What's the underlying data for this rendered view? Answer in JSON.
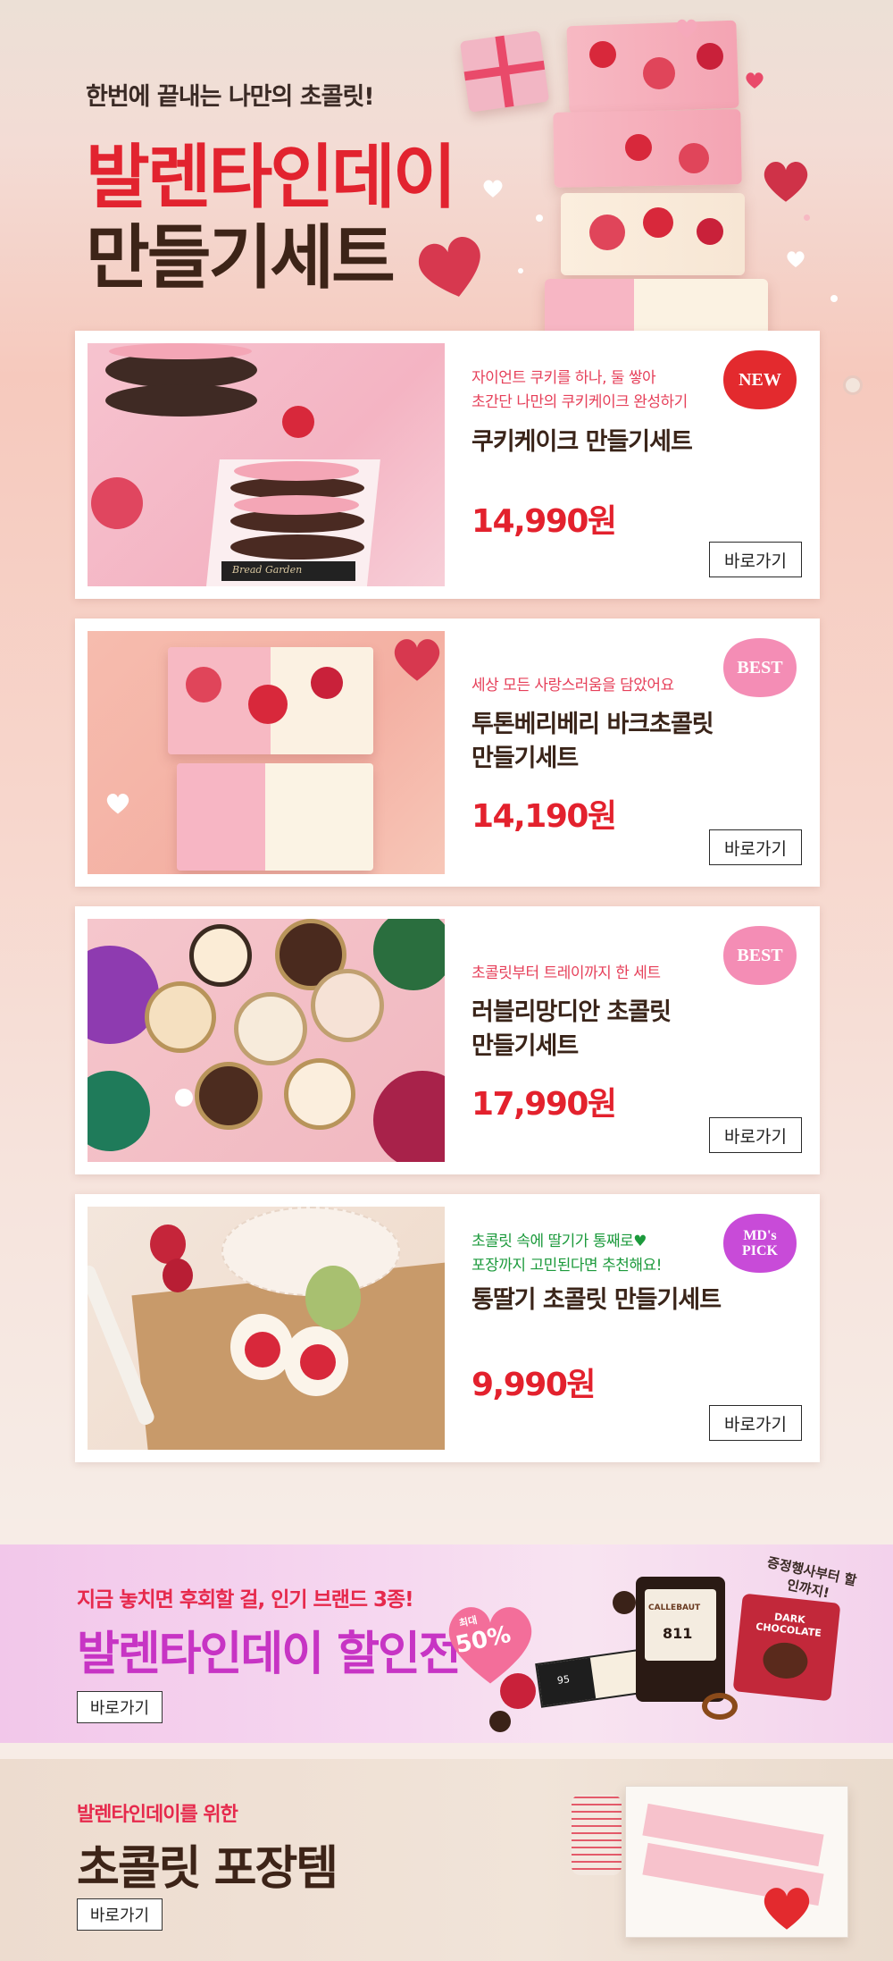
{
  "hero": {
    "pre_title": "한번에 끝내는 나만의 초콜릿!",
    "title_line1": "발렌타인데이",
    "title_line2": "만들기세트"
  },
  "products": [
    {
      "badge": "NEW",
      "description": [
        "자이언트 쿠키를 하나, 둘 쌓아",
        "초간단 나만의 쿠키케이크 완성하기"
      ],
      "name": [
        "쿠키케이크 만들기세트"
      ],
      "price": "14,990원",
      "button": "바로가기",
      "image_text": "Bread Garden"
    },
    {
      "badge": "BEST",
      "description": [
        "세상 모든 사랑스러움을 담았어요"
      ],
      "name": [
        "투톤베리베리 바크초콜릿",
        "만들기세트"
      ],
      "price": "14,190원",
      "button": "바로가기"
    },
    {
      "badge": "BEST",
      "description": [
        "초콜릿부터 트레이까지 한 세트"
      ],
      "name": [
        "러블리망디안 초콜릿",
        "만들기세트"
      ],
      "price": "17,990원",
      "button": "바로가기"
    },
    {
      "badge": "MD's PICK",
      "description": [
        "초콜릿 속에 딸기가 통째로♥",
        "포장까지 고민된다면 추천해요!"
      ],
      "name": [
        "통딸기 초콜릿 만들기세트"
      ],
      "price": "9,990원",
      "button": "바로가기"
    }
  ],
  "sale_banner": {
    "subtitle": "지금 놓치면 후회할 걸, 인기 브랜드 3종!",
    "title": "발렌타인데이 할인전",
    "discount_prefix": "최대",
    "discount": "50%",
    "note": "증정행사부터 할인까지!",
    "button": "바로가기",
    "product_labels": [
      "CALLEBAUT",
      "811",
      "DARK CHOCOLATE",
      "95"
    ]
  },
  "pack_banner": {
    "subtitle": "발렌타인데이를 위한",
    "title": "초콜릿 포장템",
    "button": "바로가기"
  },
  "colors": {
    "accent_red": "#e3212d",
    "brown": "#3d2418",
    "pink_text": "#e6405a",
    "purple_title": "#c734c4",
    "badge_new": "#e32a2e",
    "badge_best": "#f48db5",
    "badge_md": "#c84bd8"
  }
}
